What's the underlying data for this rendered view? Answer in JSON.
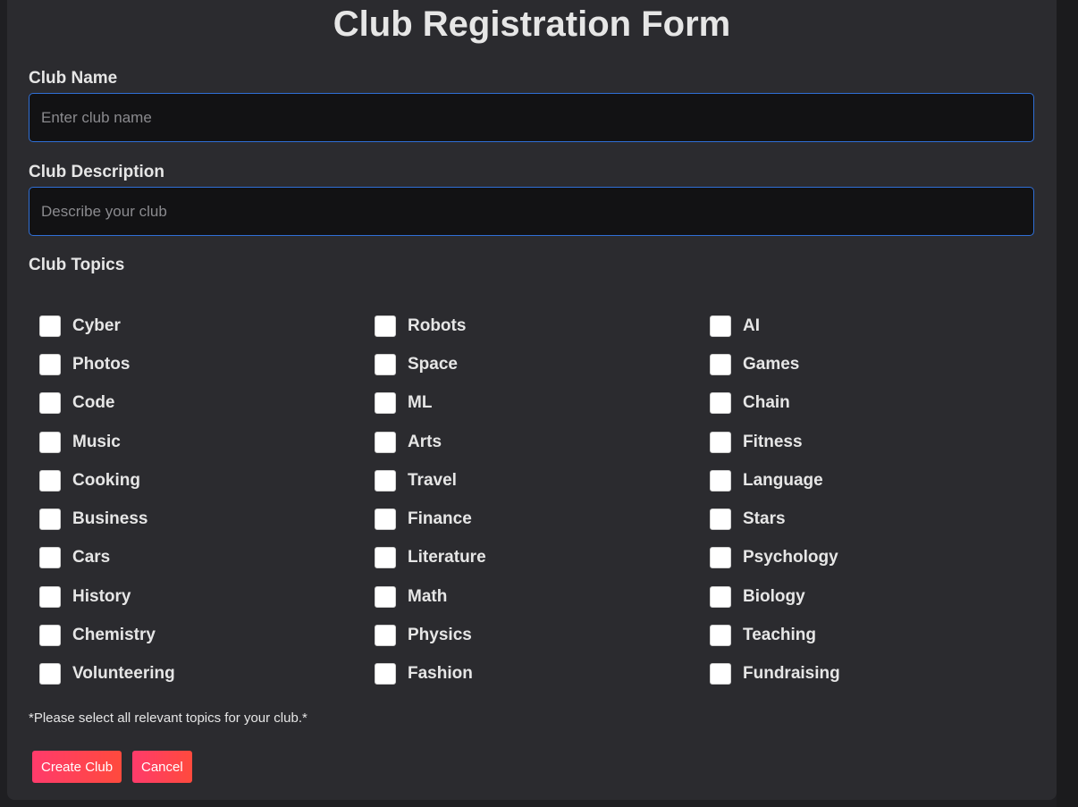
{
  "form": {
    "title": "Club Registration Form",
    "club_name": {
      "label": "Club Name",
      "placeholder": "Enter club name",
      "value": ""
    },
    "club_description": {
      "label": "Club Description",
      "placeholder": "Describe your club",
      "value": ""
    },
    "topics": {
      "label": "Club Topics",
      "items": [
        {
          "label": "Cyber",
          "checked": false
        },
        {
          "label": "Robots",
          "checked": false
        },
        {
          "label": "AI",
          "checked": false
        },
        {
          "label": "Photos",
          "checked": false
        },
        {
          "label": "Space",
          "checked": false
        },
        {
          "label": "Games",
          "checked": false
        },
        {
          "label": "Code",
          "checked": false
        },
        {
          "label": "ML",
          "checked": false
        },
        {
          "label": "Chain",
          "checked": false
        },
        {
          "label": "Music",
          "checked": false
        },
        {
          "label": "Arts",
          "checked": false
        },
        {
          "label": "Fitness",
          "checked": false
        },
        {
          "label": "Cooking",
          "checked": false
        },
        {
          "label": "Travel",
          "checked": false
        },
        {
          "label": "Language",
          "checked": false
        },
        {
          "label": "Business",
          "checked": false
        },
        {
          "label": "Finance",
          "checked": false
        },
        {
          "label": "Stars",
          "checked": false
        },
        {
          "label": "Cars",
          "checked": false
        },
        {
          "label": "Literature",
          "checked": false
        },
        {
          "label": "Psychology",
          "checked": false
        },
        {
          "label": "History",
          "checked": false
        },
        {
          "label": "Math",
          "checked": false
        },
        {
          "label": "Biology",
          "checked": false
        },
        {
          "label": "Chemistry",
          "checked": false
        },
        {
          "label": "Physics",
          "checked": false
        },
        {
          "label": "Teaching",
          "checked": false
        },
        {
          "label": "Volunteering",
          "checked": false
        },
        {
          "label": "Fashion",
          "checked": false
        },
        {
          "label": "Fundraising",
          "checked": false
        }
      ],
      "note": "*Please select all relevant topics for your club.*"
    },
    "buttons": {
      "create_label": "Create Club",
      "cancel_label": "Cancel"
    }
  },
  "colors": {
    "page_background": "#1f1f22",
    "card_background": "#2b2b2f",
    "input_background": "#121214",
    "input_border": "#2f6fd6",
    "button_gradient_start": "#ff3b6b",
    "button_gradient_end": "#ff4a3d",
    "text": "#e6e6e6"
  }
}
